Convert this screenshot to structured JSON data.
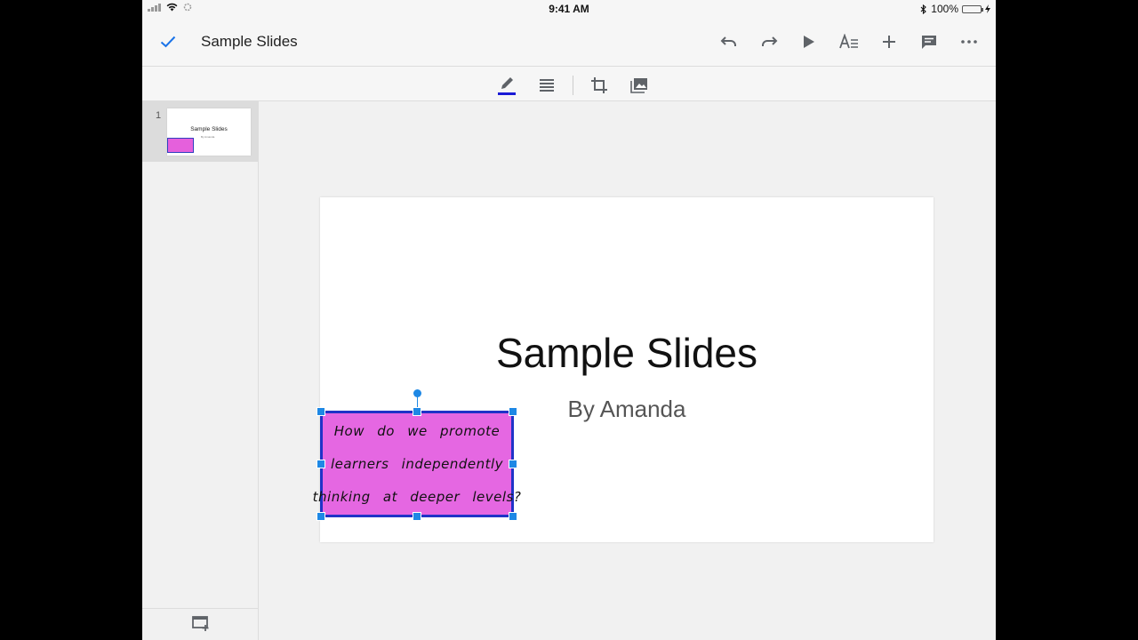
{
  "status_bar": {
    "time": "9:41 AM",
    "battery_text": "100%",
    "battery_level": 1.0
  },
  "app_bar": {
    "title": "Sample Slides",
    "icons": [
      "checkmark-icon",
      "undo-icon",
      "redo-icon",
      "play-icon",
      "text-format-icon",
      "add-icon",
      "comment-icon",
      "more-icon"
    ]
  },
  "format_toolbar": {
    "icons": [
      "pencil-icon",
      "align-icon",
      "crop-icon",
      "image-icon"
    ],
    "accent": "#1a1ad6"
  },
  "slides_panel": {
    "items": [
      {
        "number": "1",
        "title": "Sample Slides",
        "subtitle": "By Amanda"
      }
    ]
  },
  "slide": {
    "title": "Sample Slides",
    "subtitle": "By Amanda",
    "note": {
      "lines": [
        "How do we promote",
        "learners independently",
        "thinking at deeper levels?"
      ],
      "background": "#e567e2",
      "selection_color": "#1e88e5"
    }
  }
}
